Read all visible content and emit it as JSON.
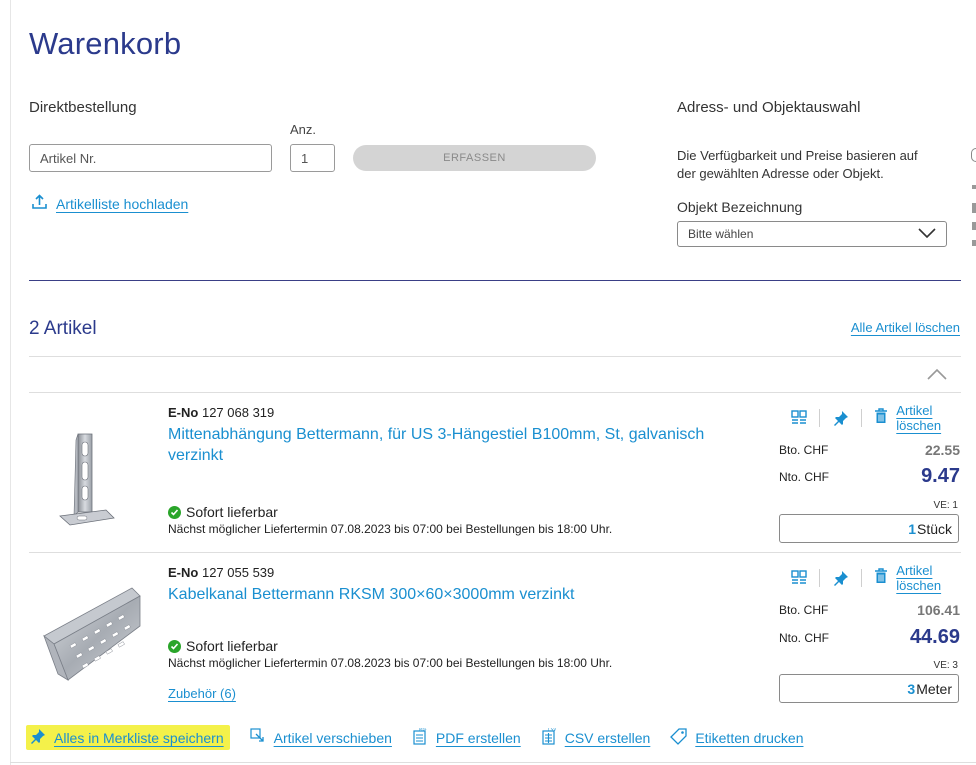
{
  "page": {
    "title": "Warenkorb"
  },
  "direct_order": {
    "heading": "Direktbestellung",
    "qty_label": "Anz.",
    "article_placeholder": "Artikel Nr.",
    "qty_value": "1",
    "submit_label": "ERFASSEN",
    "upload_link": "Artikelliste hochladen"
  },
  "address": {
    "heading": "Adress- und Objektauswahl",
    "description_line1": "Die Verfügbarkeit und Preise basieren auf",
    "description_line2": "der gewählten Adresse oder Objekt.",
    "object_label": "Objekt Bezeichnung",
    "object_select_value": "Bitte wählen"
  },
  "cart": {
    "count_label": "2 Artikel",
    "delete_all_link": "Alle Artikel löschen",
    "items": [
      {
        "eno_label": "E-No",
        "eno_value": "127 068 319",
        "title_line1": "Mittenabhängung Bettermann, für US 3-Hängestiel B100mm, St, galvanisch",
        "title_line2": "verzinkt",
        "availability": "Sofort lieferbar",
        "delivery": "Nächst möglicher Liefertermin 07.08.2023 bis 07:00 bei Bestellungen bis 18:00 Uhr.",
        "delete_link": "Artikel löschen",
        "bto_label": "Bto. CHF",
        "bto_value": "22.55",
        "nto_label": "Nto. CHF",
        "nto_value": "9.47",
        "ve": "VE: 1",
        "qty": "1",
        "unit": "Stück",
        "accessory": ""
      },
      {
        "eno_label": "E-No",
        "eno_value": "127 055 539",
        "title_line1": "Kabelkanal Bettermann RKSM 300×60×3000mm verzinkt",
        "title_line2": "",
        "availability": "Sofort lieferbar",
        "delivery": "Nächst möglicher Liefertermin 07.08.2023 bis 07:00 bei Bestellungen bis 18:00 Uhr.",
        "delete_link": "Artikel löschen",
        "bto_label": "Bto. CHF",
        "bto_value": "106.41",
        "nto_label": "Nto. CHF",
        "nto_value": "44.69",
        "ve": "VE: 3",
        "qty": "3",
        "unit": "Meter",
        "accessory": "Zubehör (6)"
      }
    ]
  },
  "actions": {
    "save_wishlist": "Alles in Merkliste speichern",
    "move": "Artikel verschieben",
    "pdf": "PDF erstellen",
    "csv": "CSV erstellen",
    "labels": "Etiketten drucken"
  },
  "colors": {
    "title_blue": "#2b3a8c",
    "link_blue": "#1a8fd0",
    "available_green": "#2aa52a",
    "highlight_yellow": "#f4f14a"
  }
}
